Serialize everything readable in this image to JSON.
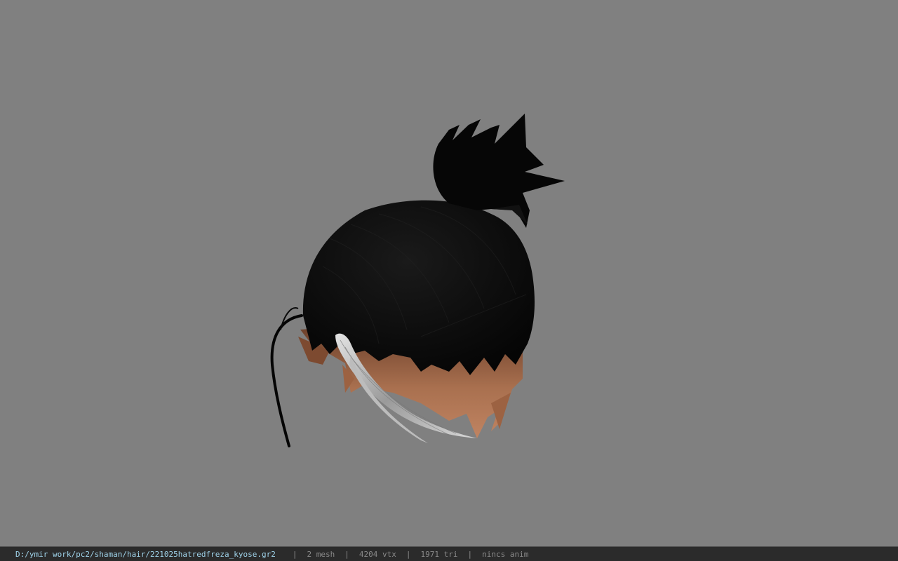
{
  "viewport": {
    "background": "#808080",
    "model": "hair-mesh",
    "colors": {
      "hair": "#0a0a0a",
      "skin": "#b57a5a",
      "ribbon": "#c8c8c8"
    }
  },
  "status_bar": {
    "file_path": "D:/ymir work/pc2/shaman/hair/221025hatredfreza_kyose.gr2",
    "separator": "|",
    "mesh_count": "2 mesh",
    "vertex_count": "4204 vtx",
    "triangle_count": "1971 tri",
    "anim_status": "nincs anim"
  }
}
